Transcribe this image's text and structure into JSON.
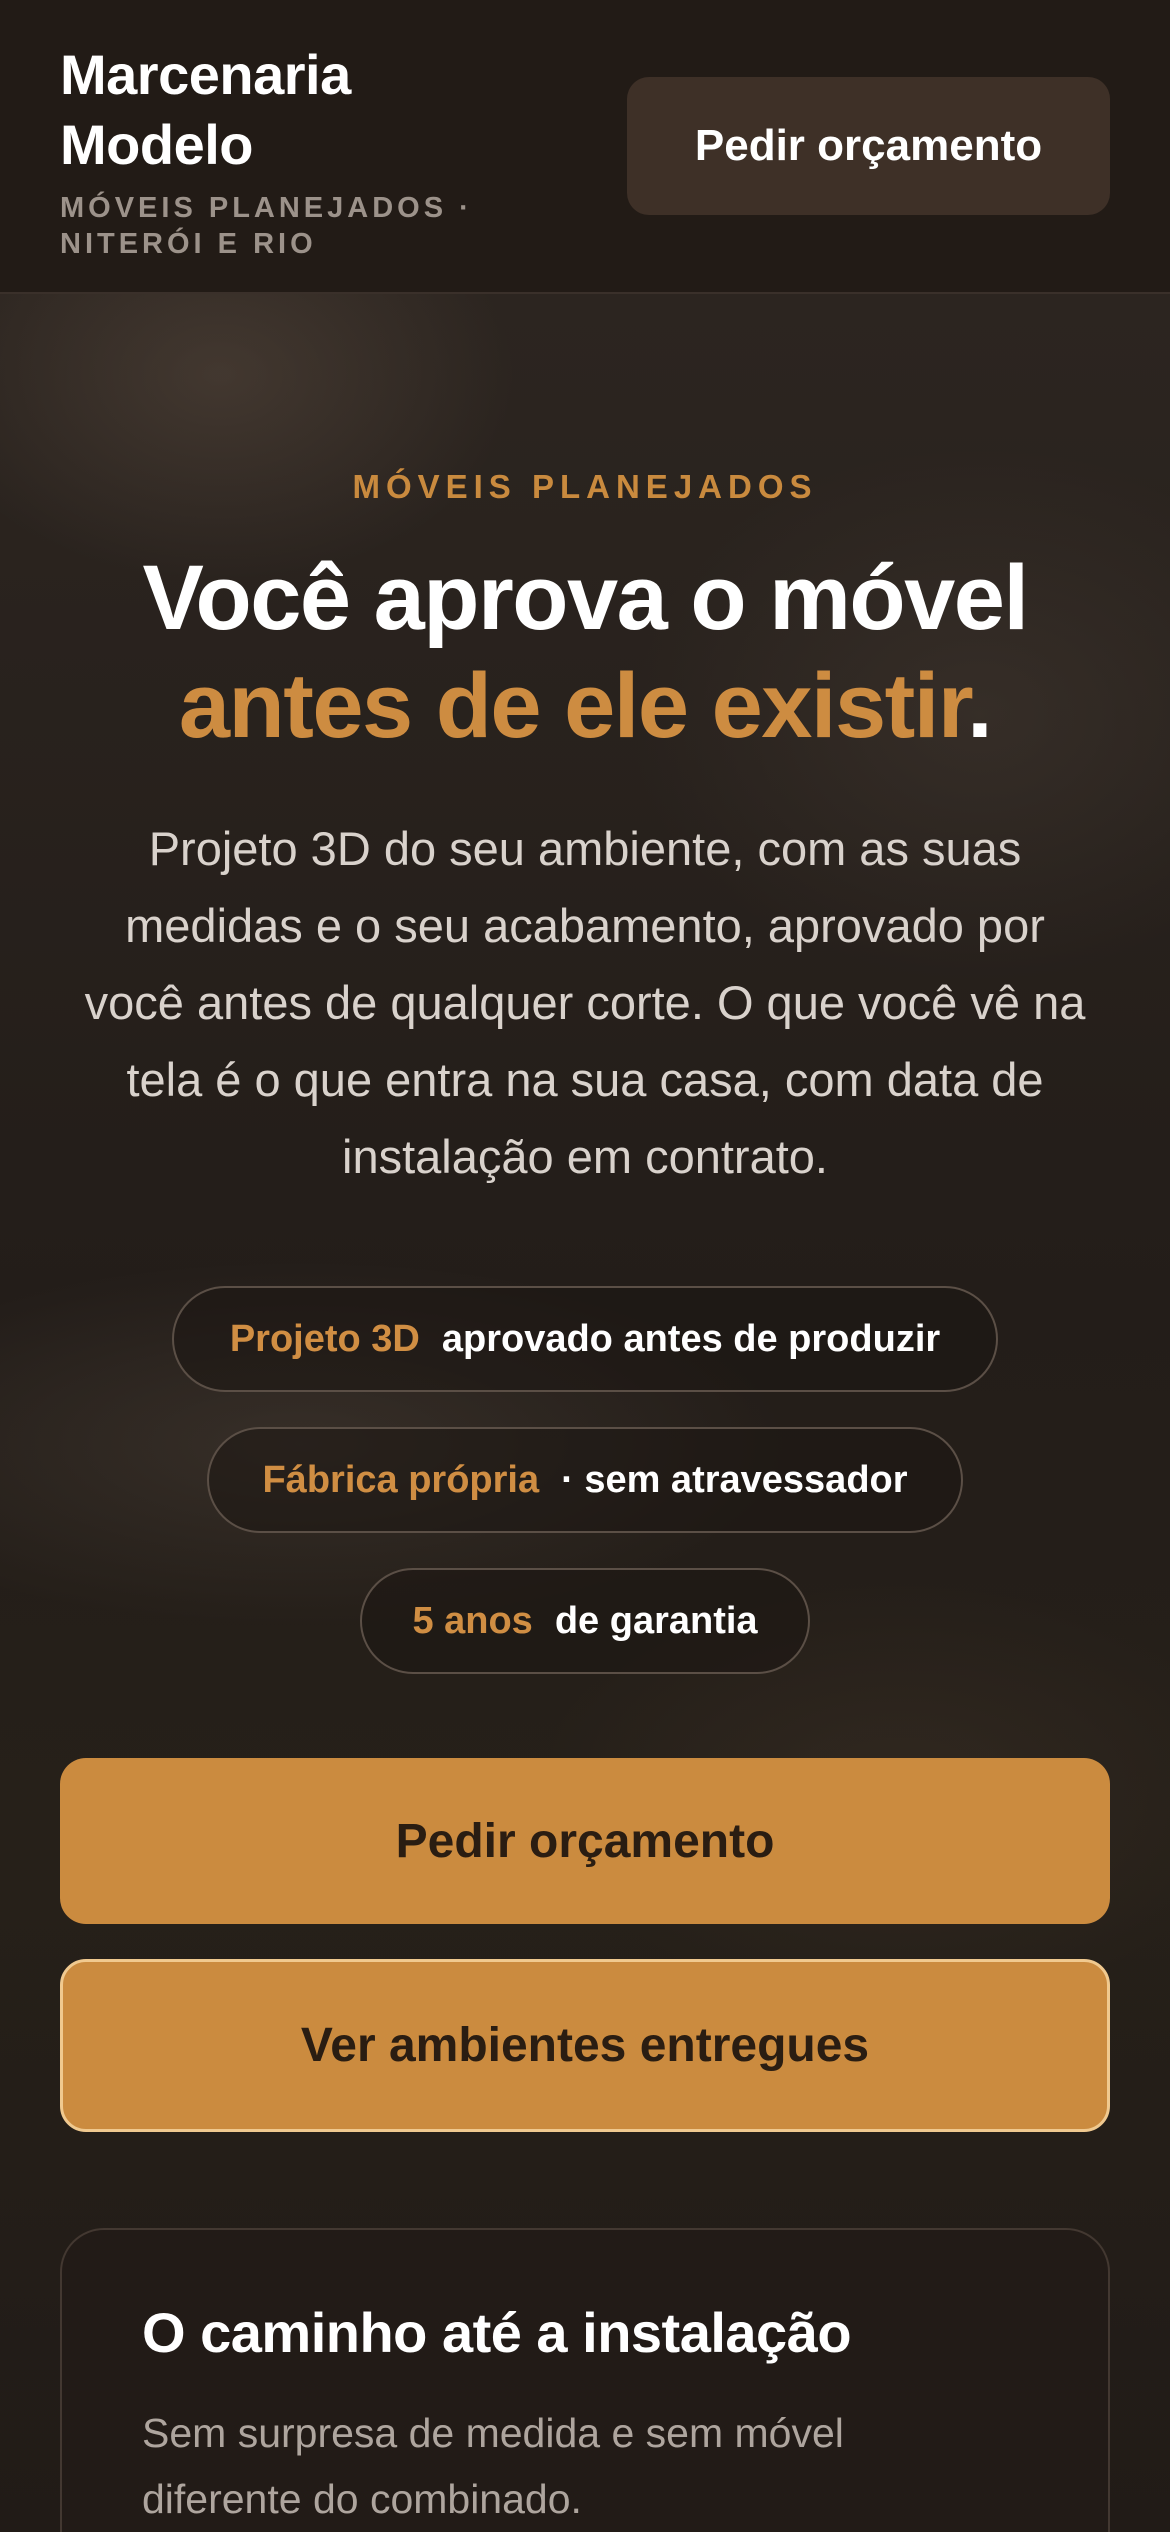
{
  "header": {
    "brand_name_line1": "Marcenaria",
    "brand_name_line2": "Modelo",
    "tagline_line1": "MÓVEIS PLANEJADOS ·",
    "tagline_line2": "NITERÓI E RIO",
    "cta_label": "Pedir orçamento"
  },
  "hero": {
    "eyebrow": "MÓVEIS PLANEJADOS",
    "headline_line1": "Você aprova o móvel",
    "headline_accent": "antes de ele existir",
    "headline_period": ".",
    "lead": "Projeto 3D do seu ambiente, com as suas medidas e o seu acabamento, aprovado por você antes de qualquer corte. O que você vê na tela é o que entra na sua casa, com data de instalação em contrato.",
    "pills": [
      {
        "highlight": "Projeto 3D",
        "text": "aprovado antes de produzir"
      },
      {
        "highlight": "Fábrica própria",
        "text": "· sem atravessador"
      },
      {
        "highlight": "5 anos",
        "text": "de garantia"
      }
    ],
    "primary_cta": "Pedir orçamento",
    "secondary_cta": "Ver ambientes entregues"
  },
  "process_card": {
    "title": "O caminho até a instalação",
    "text": "Sem surpresa de medida e sem móvel diferente do combinado."
  },
  "colors": {
    "accent": "#cb8b3f",
    "header_bg": "#221b16",
    "header_button_bg": "#3e3027",
    "page_bg": "#1e1814"
  }
}
